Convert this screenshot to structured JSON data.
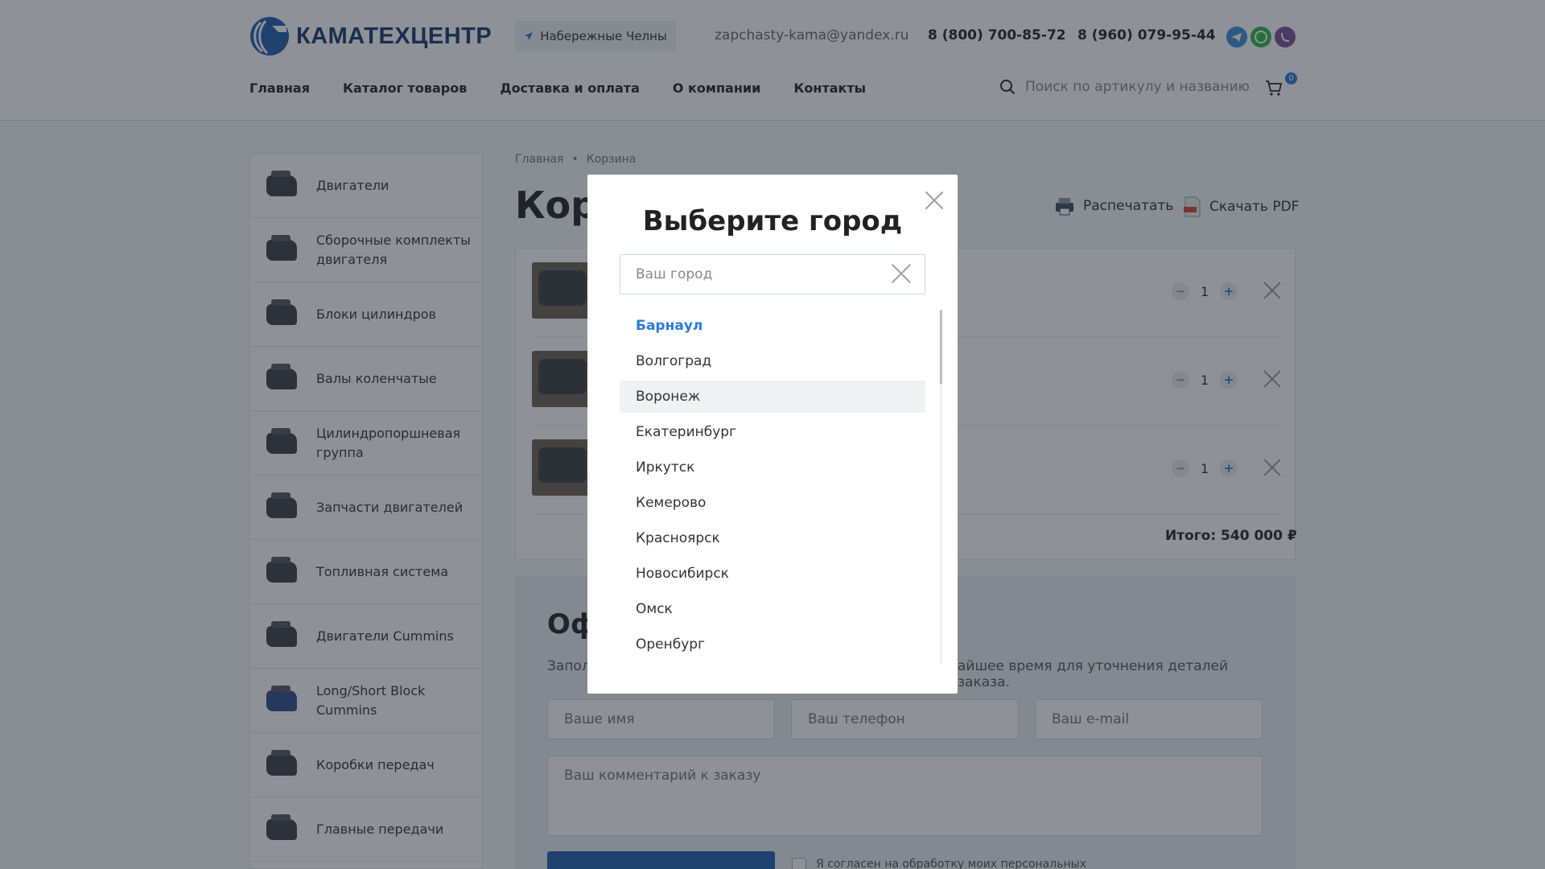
{
  "header": {
    "logo_text": "КАМАТЕХЦЕНТР",
    "city": "Набережные Челны",
    "email": "zapchasty-kama@yandex.ru",
    "phone1": "8 (800) 700-85-72",
    "phone2": "8 (960) 079-95-44",
    "messengers": [
      "telegram-icon",
      "whatsapp-icon",
      "viber-icon"
    ],
    "nav": [
      "Главная",
      "Каталог товаров",
      "Доставка и оплата",
      "О компании",
      "Контакты"
    ],
    "search_placeholder": "Поиск по артикулу и названию",
    "cart_count": "0"
  },
  "sidebar": {
    "items": [
      {
        "label": "Двигатели"
      },
      {
        "label": "Сборочные комплекты двигателя"
      },
      {
        "label": "Блоки цилиндров"
      },
      {
        "label": "Валы коленчатые"
      },
      {
        "label": "Цилиндропоршневая группа"
      },
      {
        "label": "Запчасти двигателей"
      },
      {
        "label": "Топливная система"
      },
      {
        "label": "Двигатели Cummins"
      },
      {
        "label": "Long/Short Block Cummins"
      },
      {
        "label": "Коробки передач"
      },
      {
        "label": "Главные передачи"
      }
    ]
  },
  "breadcrumb": {
    "home": "Главная",
    "separator": "•",
    "current": "Корзина"
  },
  "page": {
    "title_visible": "Кор",
    "print_label": "Распечатать",
    "pdf_label": "Скачать PDF",
    "cart_quantities": [
      "1",
      "1",
      "1"
    ],
    "total": "Итого: 540 000 ₽"
  },
  "order": {
    "title_visible": "Оф",
    "desc_left": "Запол",
    "desc_right": "айшее время для уточнения деталей заказа.",
    "name_placeholder": "Ваше имя",
    "phone_placeholder": "Ваш телефон",
    "email_placeholder": "Ваш e-mail",
    "comment_placeholder": "Ваш комментарий к заказу",
    "consent": "Я согласен на обработку моих персональных"
  },
  "modal": {
    "title": "Выберите город",
    "input_placeholder": "Ваш город",
    "cities": [
      "Барнаул",
      "Волгоград",
      "Воронеж",
      "Екатеринбург",
      "Иркутск",
      "Кемерово",
      "Красноярск",
      "Новосибирск",
      "Омск",
      "Оренбург"
    ],
    "active_city": "Барнаул",
    "hover_city": "Воронеж"
  },
  "colors": {
    "accent": "#2a7bdc",
    "brand": "#153a6e",
    "overlay": "rgba(30,36,46,0.5)"
  }
}
